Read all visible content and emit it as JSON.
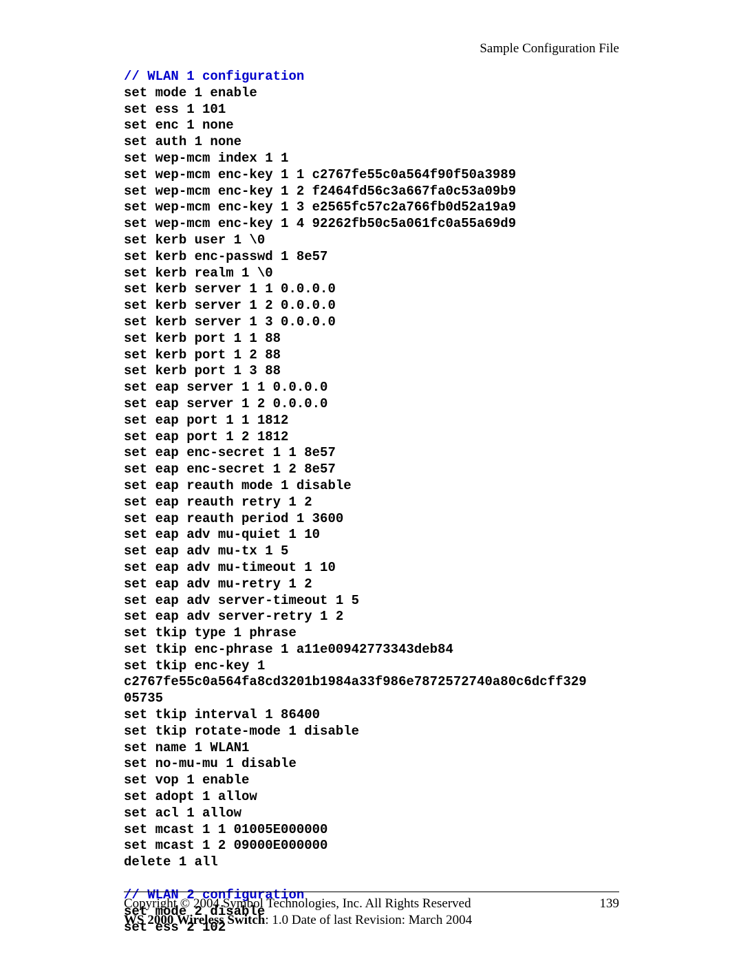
{
  "header": {
    "right": "Sample Configuration File"
  },
  "code": {
    "section1_comment": "// WLAN 1 configuration",
    "section1_lines": [
      "set mode 1 enable",
      "set ess 1 101",
      "set enc 1 none",
      "set auth 1 none",
      "set wep-mcm index 1 1",
      "set wep-mcm enc-key 1 1 c2767fe55c0a564f90f50a3989",
      "set wep-mcm enc-key 1 2 f2464fd56c3a667fa0c53a09b9",
      "set wep-mcm enc-key 1 3 e2565fc57c2a766fb0d52a19a9",
      "set wep-mcm enc-key 1 4 92262fb50c5a061fc0a55a69d9",
      "set kerb user 1 \\0",
      "set kerb enc-passwd 1 8e57",
      "set kerb realm 1 \\0",
      "set kerb server 1 1 0.0.0.0",
      "set kerb server 1 2 0.0.0.0",
      "set kerb server 1 3 0.0.0.0",
      "set kerb port 1 1 88",
      "set kerb port 1 2 88",
      "set kerb port 1 3 88",
      "set eap server 1 1 0.0.0.0",
      "set eap server 1 2 0.0.0.0",
      "set eap port 1 1 1812",
      "set eap port 1 2 1812",
      "set eap enc-secret 1 1 8e57",
      "set eap enc-secret 1 2 8e57",
      "set eap reauth mode 1 disable",
      "set eap reauth retry 1 2",
      "set eap reauth period 1 3600",
      "set eap adv mu-quiet 1 10",
      "set eap adv mu-tx 1 5",
      "set eap adv mu-timeout 1 10",
      "set eap adv mu-retry 1 2",
      "set eap adv server-timeout 1 5",
      "set eap adv server-retry 1 2",
      "set tkip type 1 phrase",
      "set tkip enc-phrase 1 a11e00942773343deb84",
      "set tkip enc-key 1",
      "c2767fe55c0a564fa8cd3201b1984a33f986e7872572740a80c6dcff329",
      "05735",
      "set tkip interval 1 86400",
      "set tkip rotate-mode 1 disable",
      "set name 1 WLAN1",
      "set no-mu-mu 1 disable",
      "set vop 1 enable",
      "set adopt 1 allow",
      "set acl 1 allow",
      "set mcast 1 1 01005E000000",
      "set mcast 1 2 09000E000000",
      "delete 1 all"
    ],
    "section2_comment": "// WLAN 2 configuration",
    "section2_lines": [
      "set mode 2 disable",
      "set ess 2 102"
    ]
  },
  "footer": {
    "copyright": "Copyright © 2004 Symbol Technologies, Inc. All Rights Reserved",
    "page_number": "139",
    "product_bold": "WS 2000 Wireless Switch",
    "product_rest": ": 1.0  Date of last Revision: March 2004"
  }
}
